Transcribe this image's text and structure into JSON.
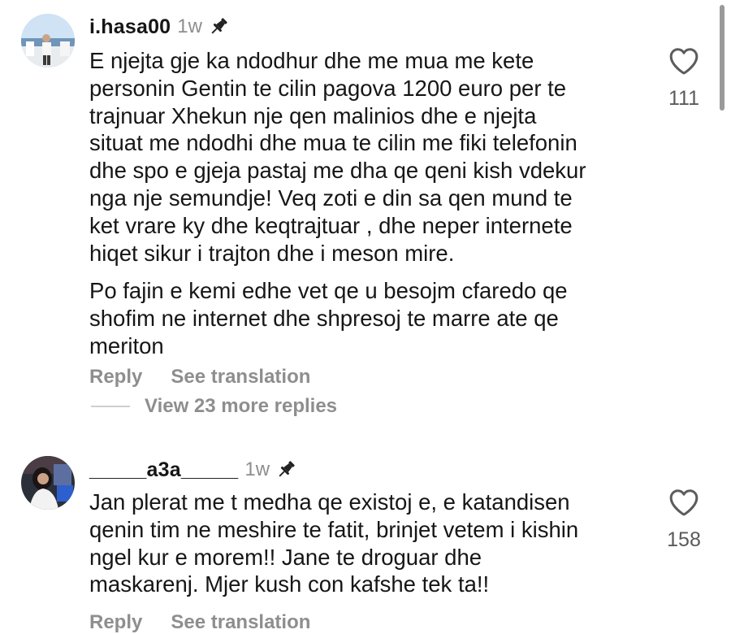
{
  "comments": [
    {
      "username": "i.hasa00",
      "time": "1w",
      "paragraphs": [
        [
          "E njejta gje ka ndodhur dhe me mua me kete",
          "personin Gentin te cilin pagova 1200 euro per te",
          "trajnuar Xhekun nje qen malinios dhe e njejta",
          "situat me ndodhi dhe mua te cilin me fiki telefonin",
          "dhe spo e gjeja pastaj me dha qe qeni kish vdekur",
          "nga nje semundje! Veq zoti e din sa qen mund te",
          "ket vrare ky dhe keqtrajtuar , dhe neper internete",
          "hiqet sikur i trajton dhe i meson mire."
        ],
        [
          "Po fajin e kemi edhe vet qe u besojm cfaredo qe",
          "shofim ne internet dhe shpresoj te marre ate qe",
          "meriton"
        ]
      ],
      "like_count": "111",
      "reply_label": "Reply",
      "translation_label": "See translation",
      "view_replies_label": "View 23 more replies"
    },
    {
      "username": "_____a3a_____",
      "time": "1w",
      "paragraphs": [
        [
          "Jan plerat me t medha qe existoj e, e katandisen",
          "qenin tim ne meshire te fatit, brinjet vetem i kishin",
          "ngel kur e morem!! Jane te droguar dhe",
          "maskarenj.  Mjer kush con kafshe tek ta!!"
        ]
      ],
      "like_count": "158",
      "reply_label": "Reply",
      "translation_label": "See translation"
    }
  ],
  "icons": {
    "pin": "pin-icon",
    "like": "heart-outline-icon"
  },
  "colors": {
    "text": "#161616",
    "secondary": "#8e8e8e",
    "count": "#5a5a5a"
  }
}
